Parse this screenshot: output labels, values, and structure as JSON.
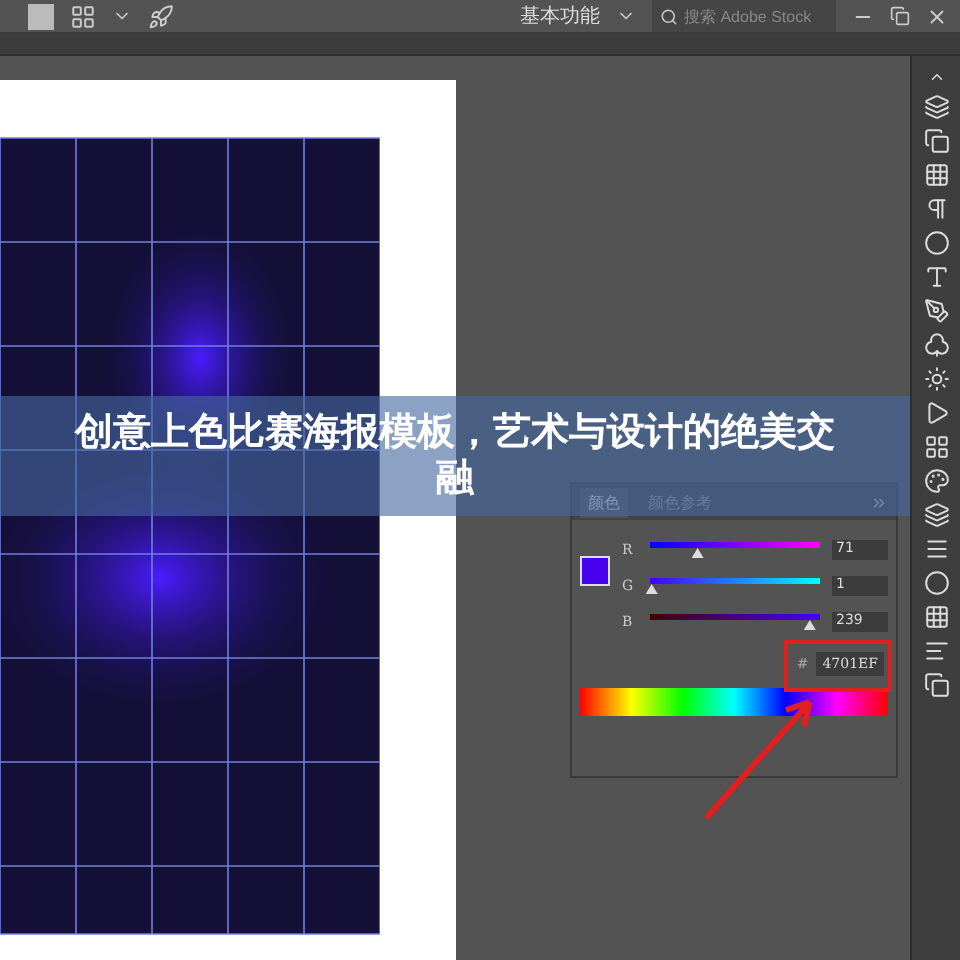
{
  "topbar": {
    "workspace": "基本功能",
    "search": {
      "placeholder": "搜索 Adobe Stock"
    }
  },
  "color_panel": {
    "tabs": [
      {
        "label": "颜色",
        "selected": true
      },
      {
        "label": "颜色参考",
        "selected": false
      }
    ],
    "channels": [
      {
        "name": "R",
        "level": 0.28,
        "value": "71"
      },
      {
        "name": "G",
        "level": 0.01,
        "value": "1"
      },
      {
        "name": "B",
        "level": 0.94,
        "value": "239"
      }
    ],
    "hash": "#",
    "hex": "4701EF"
  },
  "headline": "创意上色比赛海报模板，艺术与设计的绝美交融"
}
